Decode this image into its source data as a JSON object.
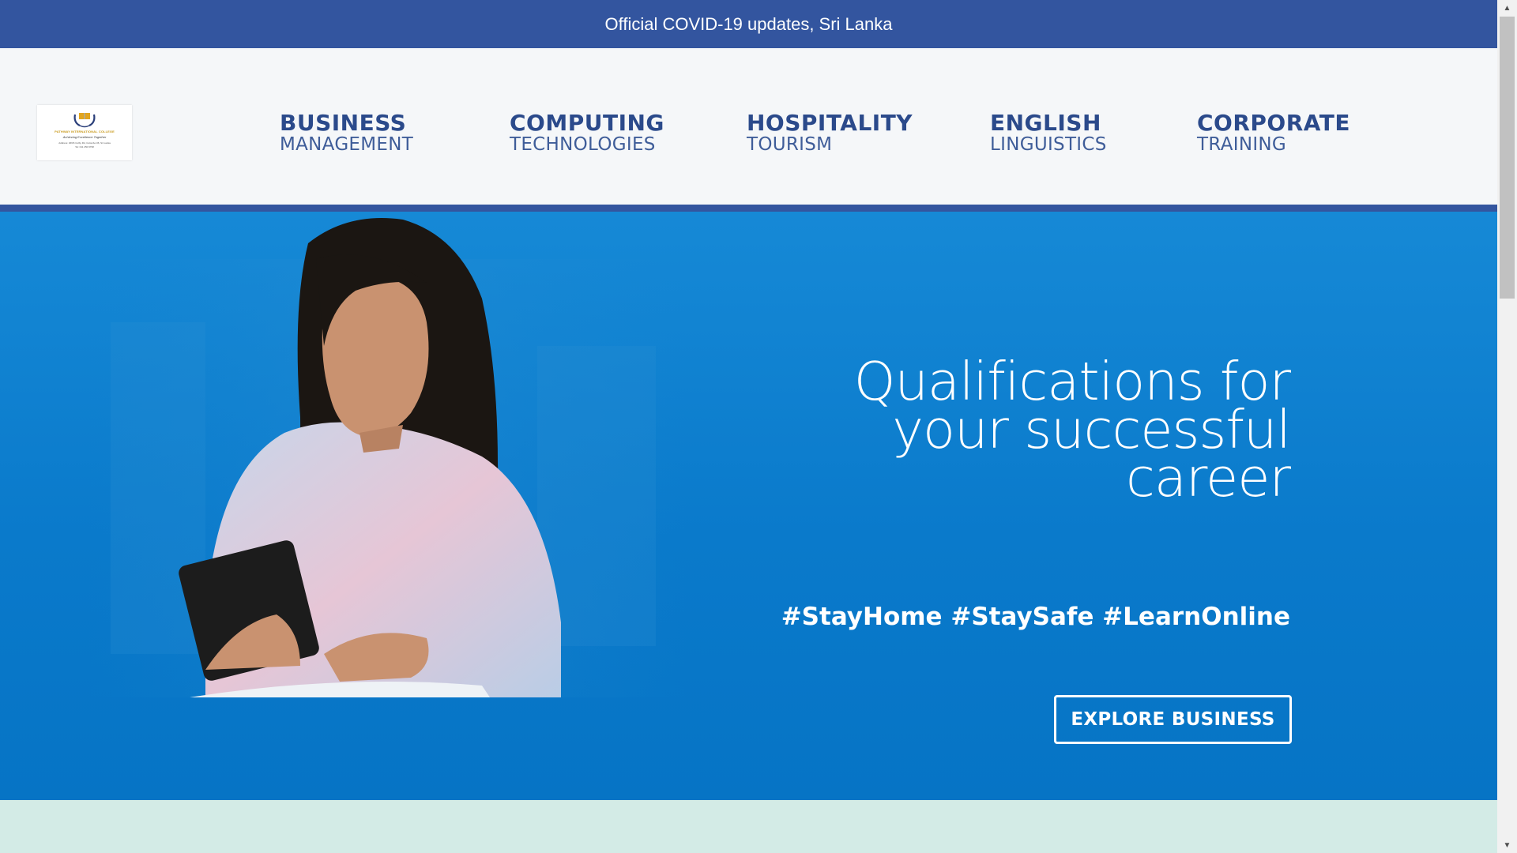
{
  "topbar": {
    "notice": "Official COVID-19 updates, Sri Lanka"
  },
  "logo": {
    "line1": "PATHWAY INTERNATIONAL COLLEGE",
    "line2": "Achieving Excellence Together",
    "line3": "Address: 466/6 Colby Rd, Colombo 06, Sri Lanka",
    "line4": "Tel: 011 250 9798"
  },
  "nav": [
    {
      "title": "BUSINESS",
      "subtitle": "MANAGEMENT"
    },
    {
      "title": "COMPUTING",
      "subtitle": "TECHNOLOGIES"
    },
    {
      "title": "HOSPITALITY",
      "subtitle": "TOURISM"
    },
    {
      "title": "ENGLISH",
      "subtitle": "LINGUISTICS"
    },
    {
      "title": "CORPORATE",
      "subtitle": "TRAINING"
    }
  ],
  "hero": {
    "title_line1": "Qualifications for",
    "title_line2": "your successful",
    "title_line3": "career",
    "tags": "#StayHome #StaySafe #LearnOnline",
    "button_label": "EXPLORE BUSINESS"
  },
  "colors": {
    "brand_navy": "#33559f",
    "hero_blue": "#0a7acb",
    "mint": "#d3ebe6"
  },
  "icons": {
    "logo": "college-crest-icon",
    "scroll_up": "scroll-up-arrow-icon",
    "scroll_down": "scroll-down-arrow-icon"
  }
}
